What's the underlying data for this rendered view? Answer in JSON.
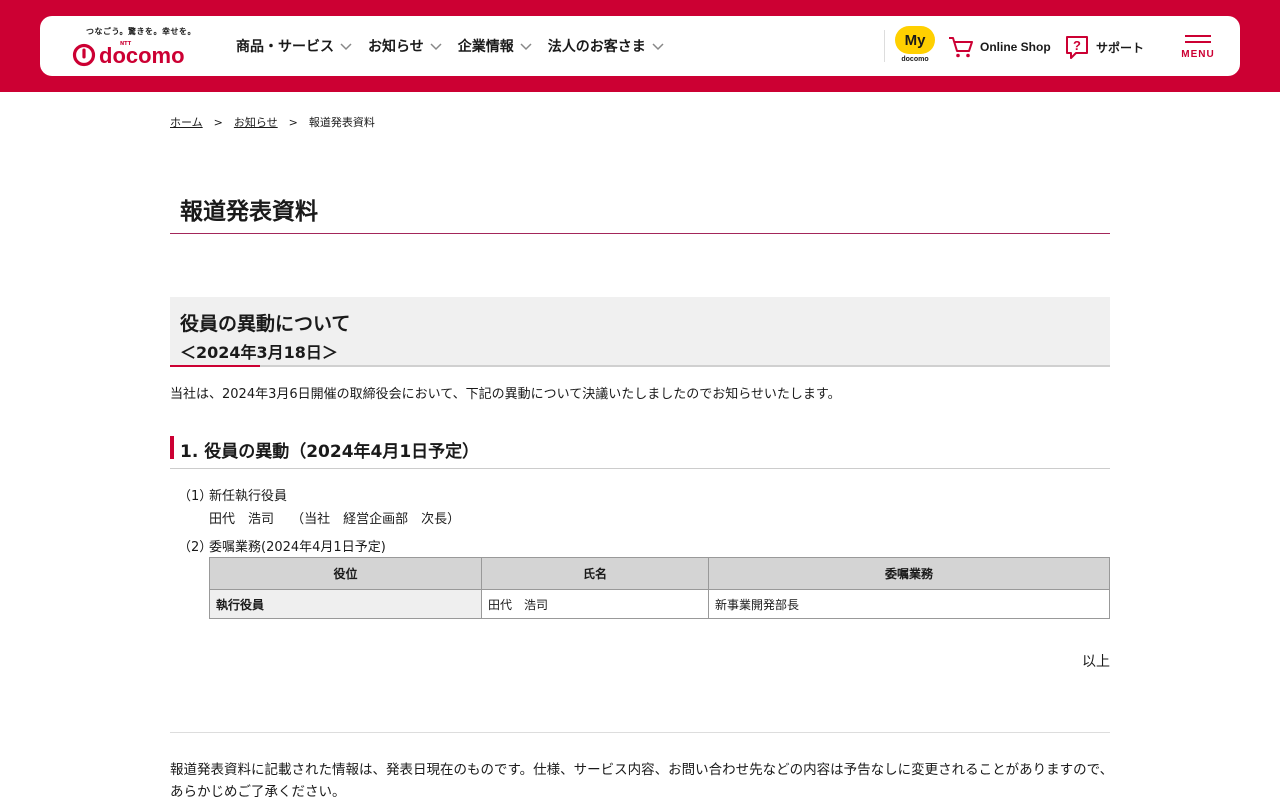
{
  "header": {
    "logo": {
      "tagline": "つなごう。驚きを。幸せを。",
      "brand_prefix": "NTT",
      "brand": "docomo"
    },
    "nav": [
      {
        "label": "商品・サービス"
      },
      {
        "label": "お知らせ"
      },
      {
        "label": "企業情報"
      },
      {
        "label": "法人のお客さま"
      }
    ],
    "my_docomo": {
      "badge": "My",
      "sub": "docomo"
    },
    "online_shop": "Online Shop",
    "support": "サポート",
    "menu": "MENU"
  },
  "breadcrumb": {
    "home": "ホーム",
    "news": "お知らせ",
    "current": "報道発表資料",
    "separator": ">"
  },
  "page_title": "報道発表資料",
  "release": {
    "title": "役員の異動について",
    "date": "＜2024年3月18日＞",
    "intro": "当社は、2024年3月6日開催の取締役会において、下記の異動について決議いたしましたのでお知らせいたします。",
    "section_heading": "1. 役員の異動（2024年4月1日予定）",
    "item1_num": "（1）",
    "item1_label": "新任執行役員",
    "item1_detail": "田代　浩司　 （当社　経営企画部　次長）",
    "item2_num": "（2）",
    "item2_label": "委嘱業務(2024年4月1日予定)",
    "table": {
      "headers": [
        "役位",
        "氏名",
        "委嘱業務"
      ],
      "rows": [
        [
          "執行役員",
          "田代　浩司",
          "新事業開発部長"
        ]
      ]
    },
    "closing": "以上",
    "notice": "報道発表資料に記載された情報は、発表日現在のものです。仕様、サービス内容、お問い合わせ先などの内容は予告なしに変更されることがありますので、あらかじめご了承ください。"
  },
  "colors": {
    "brand_red": "#cc0033",
    "title_rule": "#a3265a",
    "my_docomo_yellow": "#ffd000"
  }
}
